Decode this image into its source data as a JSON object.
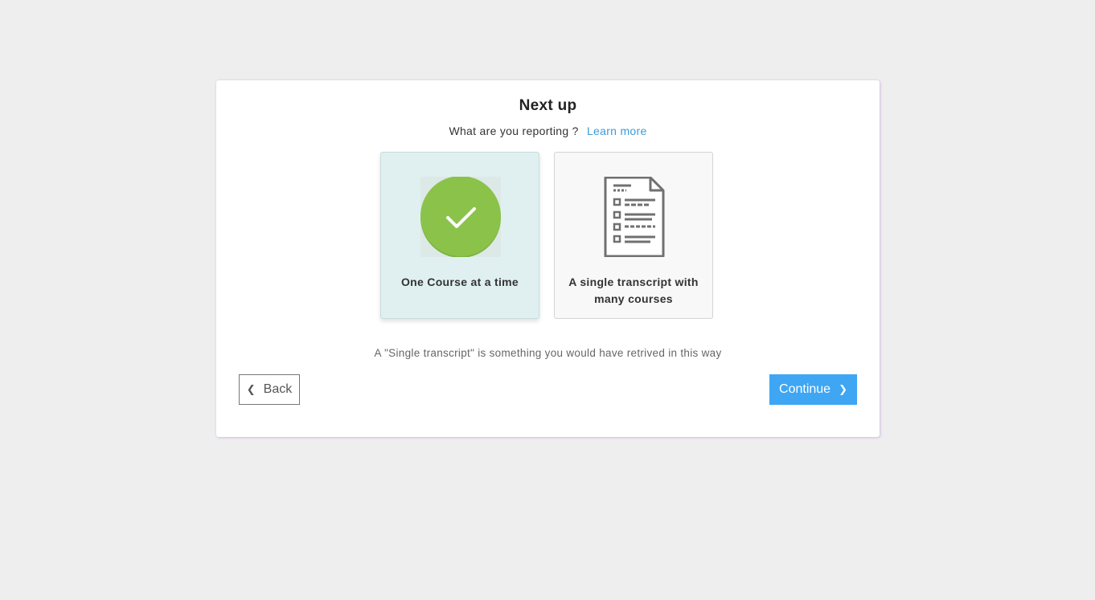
{
  "card": {
    "title": "Next up",
    "question": "What are you reporting ?",
    "learn_more": "Learn more",
    "note": "A \"Single transcript\" is something you would have retrived in this way"
  },
  "options": [
    {
      "label": "One Course at a time",
      "icon": "check-circle-icon",
      "selected": true
    },
    {
      "label": "A single transcript with many courses",
      "icon": "document-checklist-icon",
      "selected": false
    }
  ],
  "buttons": {
    "back": "Back",
    "continue": "Continue"
  },
  "colors": {
    "accent_blue": "#3ea6f3",
    "link_blue": "#3a9bd9",
    "check_green": "#8bc34a",
    "selected_bg": "#e0f0f0"
  }
}
